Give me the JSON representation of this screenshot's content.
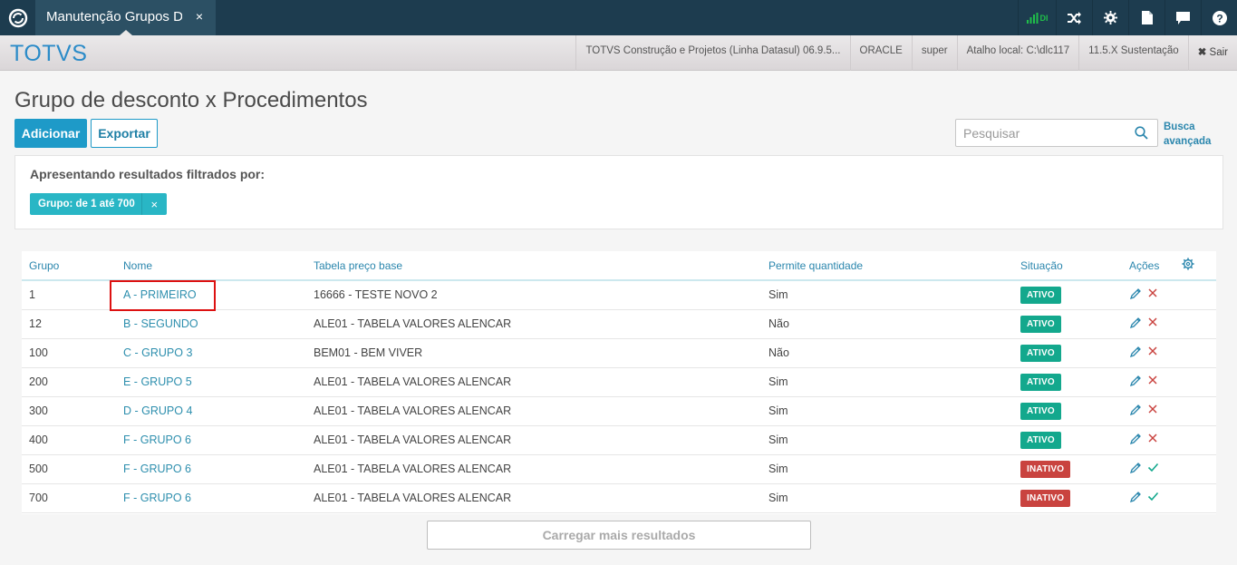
{
  "topbar": {
    "tab_label": "Manutenção Grupos D",
    "tab_close": "×",
    "signal_label": "DI",
    "icons": [
      "refresh-logo-icon",
      "signal-icon",
      "shuffle-icon",
      "gear-icon",
      "document-icon",
      "chat-icon",
      "help-icon"
    ]
  },
  "header": {
    "brand": "TOTVS",
    "product": "TOTVS Construção e Projetos (Linha Datasul) 06.9.5...",
    "database": "ORACLE",
    "user": "super",
    "shortcut": "Atalho local: C:\\dlc117",
    "version": "11.5.X Sustentação",
    "exit_label": "Sair"
  },
  "page": {
    "title": "Grupo de desconto x Procedimentos",
    "add_label": "Adicionar",
    "export_label": "Exportar",
    "search_placeholder": "Pesquisar",
    "advanced_search_line1": "Busca",
    "advanced_search_line2": "avançada"
  },
  "filter": {
    "title": "Apresentando resultados filtrados por:",
    "chip_label": "Grupo: de 1 até 700",
    "chip_close": "×"
  },
  "table": {
    "headers": {
      "grupo": "Grupo",
      "nome": "Nome",
      "tabela": "Tabela preço base",
      "permite": "Permite quantidade",
      "situacao": "Situação",
      "acoes": "Ações"
    },
    "rows": [
      {
        "grupo": "1",
        "nome": "A - PRIMEIRO",
        "tabela": "16666 - TESTE NOVO 2",
        "permite": "Sim",
        "situacao": "ATIVO"
      },
      {
        "grupo": "12",
        "nome": "B - SEGUNDO",
        "tabela": "ALE01 - TABELA VALORES ALENCAR",
        "permite": "Não",
        "situacao": "ATIVO"
      },
      {
        "grupo": "100",
        "nome": "C - GRUPO 3",
        "tabela": "BEM01 - BEM VIVER",
        "permite": "Não",
        "situacao": "ATIVO"
      },
      {
        "grupo": "200",
        "nome": "E - GRUPO 5",
        "tabela": "ALE01 - TABELA VALORES ALENCAR",
        "permite": "Sim",
        "situacao": "ATIVO"
      },
      {
        "grupo": "300",
        "nome": "D - GRUPO 4",
        "tabela": "ALE01 - TABELA VALORES ALENCAR",
        "permite": "Sim",
        "situacao": "ATIVO"
      },
      {
        "grupo": "400",
        "nome": "F - GRUPO 6",
        "tabela": "ALE01 - TABELA VALORES ALENCAR",
        "permite": "Sim",
        "situacao": "ATIVO"
      },
      {
        "grupo": "500",
        "nome": "F - GRUPO 6",
        "tabela": "ALE01 - TABELA VALORES ALENCAR",
        "permite": "Sim",
        "situacao": "INATIVO"
      },
      {
        "grupo": "700",
        "nome": "F - GRUPO 6",
        "tabela": "ALE01 - TABELA VALORES ALENCAR",
        "permite": "Sim",
        "situacao": "INATIVO"
      }
    ],
    "load_more_label": "Carregar mais resultados"
  },
  "colors": {
    "topbar": "#1d3c4f",
    "accent": "#1e9ac8",
    "active": "#13a88d",
    "inactive": "#c9433f",
    "highlight": "#dd1111"
  }
}
